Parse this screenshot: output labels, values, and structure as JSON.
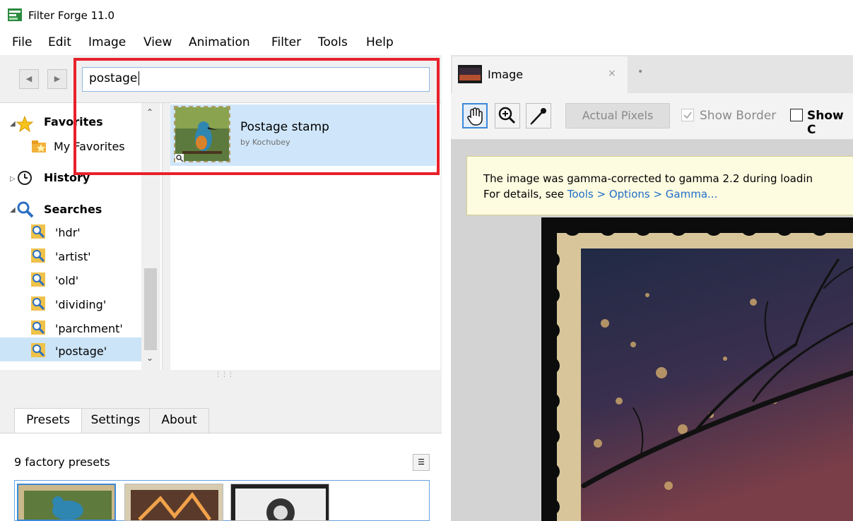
{
  "window": {
    "title": "Filter Forge 11.0"
  },
  "menu": [
    "File",
    "Edit",
    "Image",
    "View",
    "Animation",
    "Filter",
    "Tools",
    "Help"
  ],
  "search": {
    "value": "postage"
  },
  "tree": {
    "favorites": {
      "label": "Favorites",
      "child": "My Favorites"
    },
    "history": {
      "label": "History"
    },
    "searches": {
      "label": "Searches",
      "items": [
        "'hdr'",
        "'artist'",
        "'old'",
        "'dividing'",
        "'parchment'",
        "'postage'"
      ]
    }
  },
  "filter": {
    "name": "Postage stamp",
    "author": "by Kochubey"
  },
  "presets_tabs": {
    "presets": "Presets",
    "settings": "Settings",
    "about": "About"
  },
  "presets": {
    "count_label": "9 factory presets"
  },
  "image_panel": {
    "tab_label": "Image",
    "close_glyph": "×",
    "new_tab_glyph": "•"
  },
  "toolbar": {
    "actual_pixels": "Actual Pixels",
    "show_border": "Show Border",
    "show_c": "Show C"
  },
  "notice": {
    "line1": "The image was gamma-corrected to gamma 2.2 during loadin",
    "line2_prefix": "For details, see ",
    "line2_link": "Tools > Options > Gamma..."
  },
  "colors": {
    "highlight": "#e8202a",
    "selection": "#cfe6fa",
    "link": "#1f6ec8"
  }
}
